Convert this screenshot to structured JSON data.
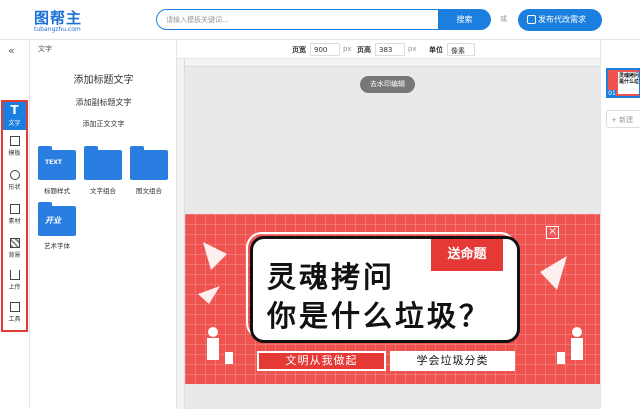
{
  "header": {
    "logo_main": "图帮主",
    "logo_sub": "tubangzhu.com",
    "search_placeholder": "请输入模板关键词...",
    "search_button": "搜索",
    "or_text": "或",
    "publish_button": "发布代改需求"
  },
  "rail": {
    "collapse_icon": "«",
    "tools": [
      {
        "label": "文字",
        "icon": "T",
        "active": true
      },
      {
        "label": "模板",
        "icon": "template-icon"
      },
      {
        "label": "形状",
        "icon": "shape-icon"
      },
      {
        "label": "素材",
        "icon": "image-icon"
      },
      {
        "label": "背景",
        "icon": "background-icon"
      },
      {
        "label": "上传",
        "icon": "upload-icon"
      },
      {
        "label": "工具",
        "icon": "toolbox-icon"
      }
    ]
  },
  "panel": {
    "title": "文字",
    "add_title": "添加标题文字",
    "add_subtitle": "添加副标题文字",
    "add_body": "添加正文文字",
    "folders": [
      {
        "label": "标题样式",
        "icon_text": "TEXT"
      },
      {
        "label": "文字组合",
        "icon_text": ""
      },
      {
        "label": "图文组合",
        "icon_text": ""
      },
      {
        "label": "艺术字体",
        "icon_text": "开业"
      }
    ]
  },
  "topbar": {
    "width_label": "页宽",
    "width_value": "900",
    "height_label": "页高",
    "height_value": "383",
    "unit_px": "px",
    "unit_label": "单位",
    "unit_value": "像素"
  },
  "canvas": {
    "watermark_button": "去水印编辑",
    "design": {
      "tag": "送命题",
      "headline_line1": "灵魂拷问",
      "headline_line2": "你是什么垃圾？",
      "slogan_left": "文明从我做起",
      "slogan_right": "学会垃圾分类",
      "close_symbol": "×"
    }
  },
  "right_panel": {
    "thumb_text": "灵魂拷问 你是什么垃圾",
    "page_number": "01",
    "new_page": "+ 新建"
  },
  "colors": {
    "brand_blue": "#1b7fe0",
    "design_red": "#ef5350",
    "highlight_red": "#e53935"
  }
}
